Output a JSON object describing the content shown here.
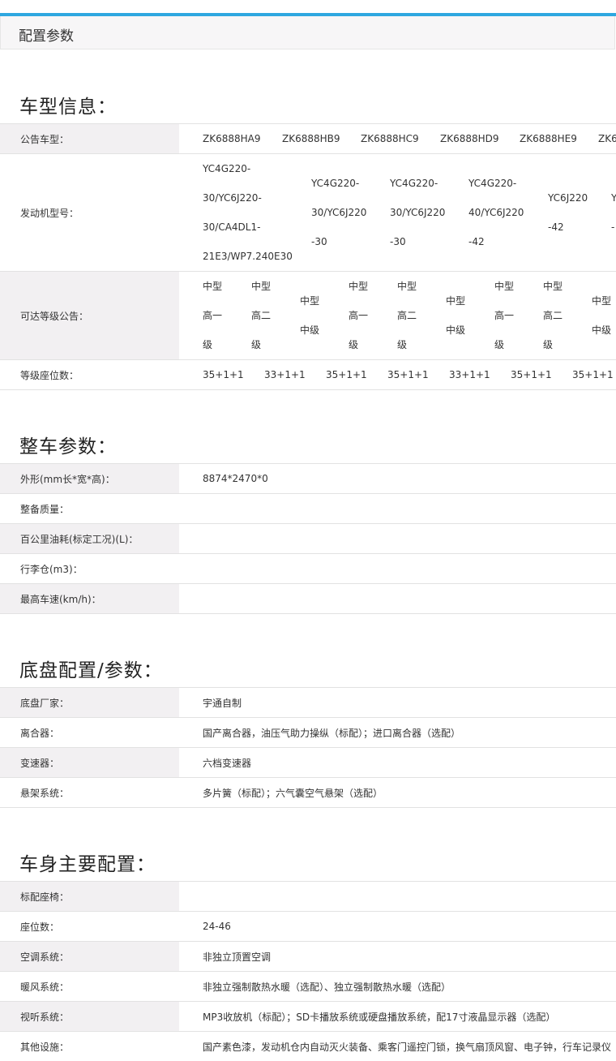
{
  "page_title": "配置参数",
  "sections": {
    "vehicle_info": {
      "title": "车型信息：",
      "announcement_label": "公告车型：",
      "models": [
        "ZK6888HA9",
        "ZK6888HB9",
        "ZK6888HC9",
        "ZK6888HD9",
        "ZK6888HE9",
        "ZK6"
      ],
      "engine_label": "发动机型号：",
      "engines": [
        [
          "YC4G220-",
          "30/YC6J220-",
          "30/CA4DL1-",
          "21E3/WP7.240E30"
        ],
        [
          "YC4G220-",
          "30/YC6J220",
          "-30"
        ],
        [
          "YC4G220-",
          "30/YC6J220",
          "-30"
        ],
        [
          "YC4G220-",
          "40/YC6J220",
          "-42"
        ],
        [
          "YC6J220",
          "-42"
        ],
        [
          "Y",
          "-"
        ]
      ],
      "grade_label": "可达等级公告：",
      "grades": [
        [
          "中型",
          "高一",
          "级"
        ],
        [
          "中型",
          "高二",
          "级"
        ],
        [
          "中型",
          "中级"
        ],
        [
          "中型",
          "高一",
          "级"
        ],
        [
          "中型",
          "高二",
          "级"
        ],
        [
          "中型",
          "中级"
        ],
        [
          "中型",
          "高一",
          "级"
        ],
        [
          "中型",
          "高二",
          "级"
        ],
        [
          "中型",
          "中级"
        ]
      ],
      "seats_label": "等级座位数：",
      "seats": [
        "35+1+1",
        "33+1+1",
        "35+1+1",
        "35+1+1",
        "33+1+1",
        "35+1+1",
        "35+1+1"
      ]
    },
    "whole_vehicle": {
      "title": "整车参数：",
      "rows": [
        {
          "label": "外形(mm长*宽*高)：",
          "value": "8874*2470*0"
        },
        {
          "label": "整备质量：",
          "value": ""
        },
        {
          "label": "百公里油耗(标定工况)(L)：",
          "value": ""
        },
        {
          "label": "行李仓(m3)：",
          "value": ""
        },
        {
          "label": "最高车速(km/h)：",
          "value": ""
        }
      ]
    },
    "chassis": {
      "title": "底盘配置/参数：",
      "rows": [
        {
          "label": "底盘厂家：",
          "value": "宇通自制"
        },
        {
          "label": "离合器：",
          "value": "国产离合器，油压气助力操纵（标配）；进口离合器（选配）"
        },
        {
          "label": "变速器：",
          "value": "六档变速器"
        },
        {
          "label": "悬架系统：",
          "value": "多片簧（标配）；六气囊空气悬架（选配）"
        }
      ]
    },
    "body": {
      "title": "车身主要配置：",
      "rows": [
        {
          "label": "标配座椅：",
          "value": ""
        },
        {
          "label": "座位数：",
          "value": "24-46"
        },
        {
          "label": "空调系统：",
          "value": "非独立顶置空调"
        },
        {
          "label": "暖风系统：",
          "value": "非独立强制散热水暖（选配）、独立强制散热水暖（选配）"
        },
        {
          "label": "视听系统：",
          "value": "MP3收放机（标配）；SD卡播放系统或硬盘播放系统，配17寸液晶显示器（选配）"
        },
        {
          "label": "其他设施：",
          "value": "国产素色漆，发动机仓内自动灭火装备、乘客门遥控门锁，换气扇顶风窗、电子钟，行车记录仪"
        }
      ]
    }
  }
}
